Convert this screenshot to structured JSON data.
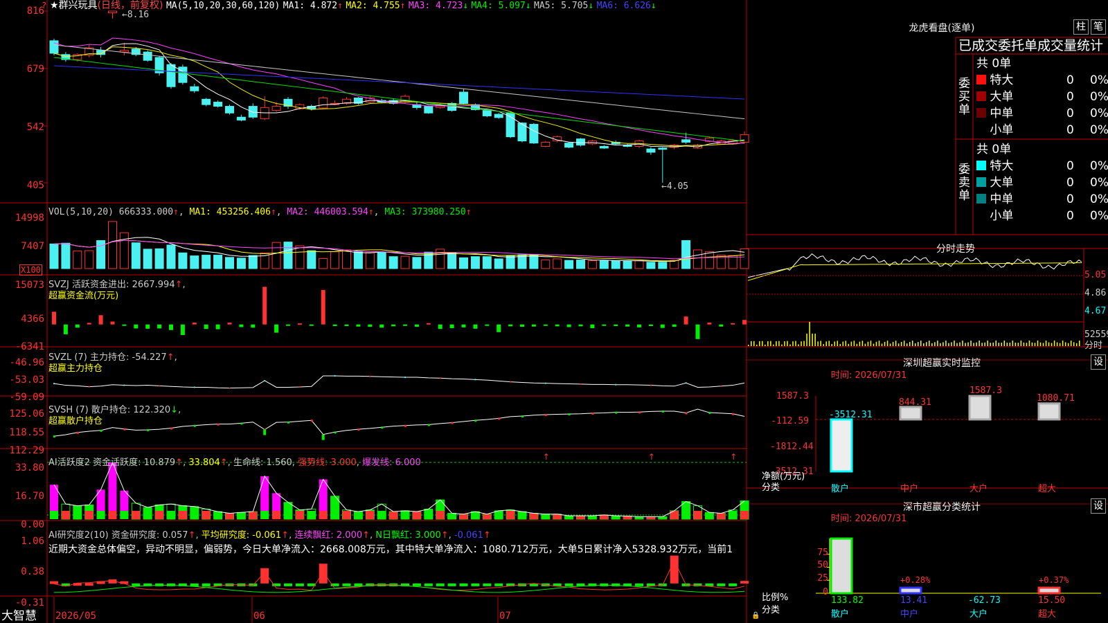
{
  "colors": {
    "up": "#ff3232",
    "down": "#4bf0f0",
    "grid": "#c00000",
    "ma1": "#ffffff",
    "ma2": "#f0f000",
    "ma3": "#ff40ff",
    "ma4": "#00e000",
    "ma5": "#c8c8c8",
    "ma6": "#3030ff"
  },
  "header": {
    "star": "★",
    "stock_name": "群兴玩具",
    "period": "(日线，前复权)",
    "ma_params": "MA(5,10,20,30,60,120)",
    "ma1_label": "MA1:",
    "ma1_value": "4.872",
    "ma2_label": "MA2:",
    "ma2_value": "4.755",
    "ma3_label": "MA3:",
    "ma3_value": "4.723",
    "ma4_label": "MA4:",
    "ma4_value": "5.097",
    "ma5_label": "MA5:",
    "ma5_value": "5.705",
    "ma6_label": "MA6:",
    "ma6_value": "6.626",
    "up_arrow": "↑",
    "down_arrow": "↓"
  },
  "candle_panel": {
    "y_ticks": [
      "816",
      "679",
      "542",
      "405"
    ],
    "high_label": "8.16",
    "low_label": "4.05",
    "question": "?"
  },
  "vol_panel": {
    "title": "VOL(5,10,20)",
    "value": "666333.000",
    "ma1_label": "MA1:",
    "ma1_value": "453256.406",
    "ma2_label": "MA2:",
    "ma2_value": "446003.594",
    "ma3_label": "MA3:",
    "ma3_value": "373980.250",
    "y_ticks": [
      "14998",
      "7407"
    ],
    "unit": "X100"
  },
  "svzj_panel": {
    "title": "SVZJ",
    "name": "活跃资金进出:",
    "value": "2667.994",
    "subtitle": "超赢资金流(万元)",
    "y_ticks": [
      "15073",
      "4366",
      "-6341"
    ]
  },
  "svzl_panel": {
    "title": "SVZL (7)",
    "name": "主力持仓:",
    "value": "-54.227",
    "subtitle": "超赢主力持仓",
    "y_ticks": [
      "-46.96",
      "-53.03",
      "-59.09"
    ]
  },
  "svsh_panel": {
    "title": "SVSH (7)",
    "name": "散户持仓:",
    "value": "122.320",
    "subtitle": "超赢散户持仓",
    "y_ticks": [
      "125.06",
      "118.55",
      "112.29"
    ]
  },
  "ai1_panel": {
    "title": "AI活跃度2",
    "name": "资金活跃度:",
    "value": "10.879",
    "v2": "33.804",
    "life_label": "生命线:",
    "life_value": "1.560",
    "strong_label": "强势线:",
    "strong_value": "3.000",
    "burst_label": "爆发线:",
    "burst_value": "6.000",
    "y_ticks": [
      "33.80",
      "16.70",
      "0.00"
    ]
  },
  "ai2_panel": {
    "title": "AI研究度2(10)",
    "name": "资金研究度:",
    "value": "0.057",
    "avg_label": "平均研究度:",
    "avg_value": "-0.061",
    "cont_label": "连续飘红:",
    "cont_value": "2.000",
    "n_label": "N日飘红:",
    "n_value": "3.000",
    "last_value": "-0.061",
    "text": "近期大资金总体偏空，异动不明显，偏弱势，今日大单净流入：2668.008万元，其中特大单净流入：1080.712万元，大单5日累计净入5328.932万元，当前1",
    "y_ticks": [
      "1.06",
      "0.38",
      "-0.31"
    ]
  },
  "x_axis": {
    "labels": [
      "2026/05",
      "06",
      "07"
    ],
    "brand": "大智慧"
  },
  "lhb": {
    "title": "龙虎看盘(逐单)",
    "tab1": "柱",
    "tab2": "笔",
    "subheader": "已成交委托单成交量统计",
    "buy": {
      "side": "委买单",
      "total": "共 0单",
      "rows": [
        {
          "name": "特大",
          "count": "0",
          "pct": "0%",
          "color": "#ff1010"
        },
        {
          "name": "大单",
          "count": "0",
          "pct": "0%",
          "color": "#a00000"
        },
        {
          "name": "中单",
          "count": "0",
          "pct": "0%",
          "color": "#6a0000"
        },
        {
          "name": "小单",
          "count": "0",
          "pct": "0%",
          "color": "#000000"
        }
      ]
    },
    "sell": {
      "side": "委卖单",
      "total": "共 0单",
      "rows": [
        {
          "name": "特大",
          "count": "0",
          "pct": "0%",
          "color": "#00ffff"
        },
        {
          "name": "大单",
          "count": "0",
          "pct": "0%",
          "color": "#00a0a0"
        },
        {
          "name": "中单",
          "count": "0",
          "pct": "0%",
          "color": "#008080"
        },
        {
          "name": "小单",
          "count": "0",
          "pct": "0%",
          "color": "#000000"
        }
      ]
    }
  },
  "timeshare": {
    "title": "分时走势",
    "y_labels": [
      "5.05",
      "4.86",
      "4.67",
      "52559",
      "分时"
    ]
  },
  "sz_monitor": {
    "title": "深圳超赢实时监控",
    "settings": "设",
    "time": "时间: 2026/07/31",
    "y_ticks": [
      "1587.3",
      "-112.59",
      "-1812.44",
      "-3512.31"
    ],
    "ylabel": "净额(万元)",
    "xlabel": "分类",
    "categories": [
      "散户",
      "中户",
      "大户",
      "超大"
    ],
    "values": [
      -3512.31,
      844.31,
      1587.3,
      1080.71
    ],
    "value_labels": [
      "-3512.31",
      "844.31",
      "1587.3",
      "1080.71"
    ]
  },
  "sz_classify": {
    "title": "深市超赢分类统计",
    "settings": "设",
    "time": "时间: 2026/07/31",
    "y_ticks": [
      "75",
      "50",
      "25",
      "0"
    ],
    "ylabel": "比例%",
    "xlabel": "分类",
    "categories": [
      "散户",
      "中户",
      "大户",
      "超大"
    ],
    "values": [
      133.82,
      13.41,
      -62.73,
      15.5
    ],
    "value_labels": [
      "133.82",
      "13.41",
      "-62.73",
      "15.50"
    ],
    "pct_labels": [
      "",
      "+0.28%",
      "",
      "+0.37%"
    ]
  },
  "chart_data": [
    {
      "type": "candlestick",
      "title": "群兴玩具(日线，前复权)",
      "ylim": [
        4.05,
        8.16
      ],
      "y_ticks": [
        8.16,
        6.79,
        5.42,
        4.05
      ],
      "x_labels": [
        "2026/05",
        "06",
        "07"
      ],
      "count": 60,
      "opens": [
        7.45,
        7.12,
        7.0,
        7.1,
        7.22,
        8.12,
        7.18,
        7.25,
        7.18,
        7.05,
        6.88,
        6.82,
        6.35,
        6.05,
        5.98,
        5.88,
        5.62,
        5.88,
        5.58,
        5.78,
        6.05,
        5.82,
        5.88,
        5.84,
        5.92,
        5.95,
        6.08,
        5.98,
        6.02,
        6.02,
        5.98,
        5.92,
        5.88,
        5.85,
        5.95,
        6.22,
        5.92,
        5.78,
        5.69,
        5.72,
        5.48,
        5.45,
        4.92,
        5.05,
        5.0,
        5.1,
        4.98,
        4.92,
        5.02,
        4.95,
        4.92,
        4.86,
        4.88,
        4.9,
        5.08,
        4.88,
        5.04,
        4.98,
        4.98,
        5.02
      ],
      "closes": [
        7.15,
        7.0,
        7.12,
        7.28,
        7.12,
        8.16,
        7.22,
        7.12,
        6.98,
        6.68,
        6.35,
        6.45,
        6.25,
        5.92,
        5.88,
        5.72,
        5.55,
        5.62,
        5.85,
        5.88,
        5.88,
        5.92,
        5.82,
        6.08,
        5.95,
        6.05,
        5.95,
        6.08,
        5.98,
        5.95,
        6.12,
        5.85,
        5.72,
        5.9,
        5.78,
        5.95,
        5.8,
        5.65,
        5.61,
        5.15,
        5.05,
        5.0,
        5.02,
        5.15,
        4.9,
        4.95,
        5.05,
        4.88,
        4.98,
        4.92,
        5.05,
        4.78,
        4.85,
        4.95,
        5.02,
        4.95,
        5.12,
        5.05,
        5.06,
        5.2
      ],
      "highs": [
        7.5,
        7.18,
        7.15,
        7.35,
        7.3,
        8.16,
        7.4,
        7.3,
        7.22,
        7.08,
        6.92,
        6.88,
        6.42,
        6.08,
        6.02,
        5.92,
        5.68,
        5.95,
        6.12,
        5.98,
        6.1,
        5.95,
        5.92,
        6.12,
        6.02,
        6.1,
        6.1,
        6.12,
        6.06,
        6.06,
        6.16,
        5.98,
        5.9,
        5.95,
        5.98,
        6.3,
        5.95,
        5.8,
        5.72,
        5.75,
        5.5,
        5.48,
        5.05,
        5.18,
        5.02,
        5.12,
        5.08,
        4.95,
        5.06,
        4.98,
        5.08,
        4.9,
        4.9,
        4.98,
        5.25,
        4.98,
        5.15,
        5.08,
        5.1,
        5.28
      ],
      "lows": [
        7.1,
        6.95,
        6.95,
        7.05,
        7.05,
        7.98,
        7.1,
        7.08,
        6.95,
        6.62,
        6.3,
        6.4,
        6.2,
        5.88,
        5.85,
        5.68,
        5.52,
        5.58,
        5.55,
        5.75,
        5.82,
        5.8,
        5.78,
        5.82,
        5.9,
        5.92,
        5.92,
        5.95,
        5.95,
        5.92,
        5.95,
        5.8,
        5.7,
        5.82,
        5.75,
        5.92,
        5.78,
        5.62,
        5.58,
        5.12,
        5.02,
        4.98,
        4.9,
        5.02,
        4.88,
        4.92,
        4.95,
        4.86,
        4.95,
        4.9,
        4.88,
        4.72,
        4.05,
        4.85,
        4.98,
        4.86,
        5.02,
        4.96,
        4.96,
        5.0
      ]
    },
    {
      "type": "bar",
      "title": "VOL(5,10,20)",
      "ylim": [
        0,
        14998
      ],
      "values": [
        6600,
        6800,
        4700,
        4800,
        7500,
        12600,
        9600,
        6900,
        5200,
        5300,
        6300,
        4200,
        3400,
        3600,
        3600,
        3000,
        2800,
        3500,
        4200,
        7000,
        7100,
        6100,
        4800,
        2700,
        4500,
        5000,
        4500,
        4300,
        4300,
        3200,
        3300,
        3000,
        4400,
        5200,
        4200,
        2900,
        3200,
        3200,
        2600,
        3500,
        3700,
        3800,
        2300,
        2600,
        2200,
        2300,
        2100,
        2100,
        2100,
        2000,
        2100,
        1700,
        1700,
        2200,
        7500,
        5000,
        4500,
        3600,
        3500,
        5300
      ]
    },
    {
      "type": "bar",
      "title": "SVZJ 活跃资金进出",
      "ylim": [
        -6341,
        15073
      ],
      "values": [
        4800,
        -3700,
        -1200,
        600,
        3500,
        1100,
        -200,
        -1500,
        -1600,
        -1500,
        -2100,
        -4000,
        700,
        -1700,
        -1800,
        700,
        -1000,
        -1200,
        14200,
        -3100,
        -500,
        400,
        -300,
        13000,
        -600,
        -600,
        -800,
        -900,
        -1200,
        -700,
        -500,
        -900,
        500,
        -1700,
        -1400,
        -1100,
        -1600,
        -500,
        -2900,
        -700,
        -900,
        -800,
        -500,
        -700,
        -1000,
        -700,
        -1400,
        -500,
        -600,
        -800,
        -1100,
        -600,
        -1300,
        -900,
        3000,
        -5500,
        700,
        -800,
        500,
        1700
      ]
    },
    {
      "type": "line",
      "title": "SVZL 主力持仓",
      "ylim": [
        -59.09,
        -46.96
      ],
      "values": [
        -56.2,
        -56.8,
        -57.0,
        -57.3,
        -57.1,
        -56.6,
        -56.8,
        -56.9,
        -56.8,
        -57.0,
        -57.2,
        -57.4,
        -57.5,
        -57.5,
        -57.7,
        -57.8,
        -57.7,
        -57.6,
        -55.2,
        -57.5,
        -57.5,
        -57.4,
        -57.2,
        -53.5,
        -53.5,
        -53.6,
        -53.6,
        -53.7,
        -53.8,
        -53.9,
        -54.0,
        -54.0,
        -54.2,
        -54.3,
        -54.5,
        -54.6,
        -54.8,
        -55.0,
        -55.3,
        -55.6,
        -55.8,
        -56.0,
        -56.1,
        -56.2,
        -56.3,
        -56.4,
        -56.5,
        -56.5,
        -56.6,
        -56.6,
        -56.7,
        -56.8,
        -57.0,
        -57.1,
        -56.0,
        -57.5,
        -57.4,
        -57.1,
        -56.8,
        -56.0
      ]
    },
    {
      "type": "line",
      "title": "SVSH 散户持仓",
      "ylim": [
        112.29,
        125.06
      ],
      "values": [
        115.4,
        115.9,
        116.7,
        117.1,
        117.4,
        118.4,
        117.9,
        117.5,
        117.6,
        117.8,
        118.2,
        118.8,
        119.1,
        119.4,
        119.6,
        119.6,
        119.9,
        120.3,
        117.7,
        120.2,
        120.3,
        120.6,
        120.9,
        116.0,
        116.8,
        117.4,
        117.8,
        118.1,
        118.5,
        118.9,
        119.1,
        119.3,
        119.4,
        119.8,
        120.1,
        120.5,
        120.9,
        121.2,
        121.6,
        122.2,
        122.4,
        122.7,
        122.9,
        123.0,
        123.1,
        123.2,
        123.4,
        123.5,
        123.7,
        123.7,
        123.8,
        124.0,
        124.1,
        124.1,
        123.5,
        124.8,
        123.6,
        123.4,
        123.2,
        122.3
      ]
    },
    {
      "type": "bar",
      "title": "AI活跃度2 资金活跃度",
      "ylim": [
        0,
        33.8
      ],
      "values": [
        20.5,
        9.0,
        8.0,
        8.5,
        17.6,
        33.8,
        17.0,
        9.5,
        7.0,
        8.5,
        9.0,
        8.0,
        7.5,
        6.0,
        4.5,
        3.5,
        4.0,
        4.5,
        25.6,
        15.5,
        10.0,
        5.5,
        6.0,
        23.7,
        13.7,
        5.5,
        4.5,
        5.5,
        9.0,
        4.5,
        5.0,
        4.5,
        6.0,
        11.5,
        3.5,
        3.0,
        4.5,
        3.0,
        5.0,
        5.5,
        4.5,
        3.5,
        3.0,
        3.0,
        2.0,
        2.0,
        2.0,
        2.5,
        2.0,
        1.8,
        1.5,
        1.5,
        1.5,
        5.0,
        10.5,
        8.0,
        4.0,
        3.5,
        5.5,
        10.9
      ]
    },
    {
      "type": "bar",
      "title": "AI研究度2(10) 资金研究度",
      "ylim": [
        -0.31,
        1.06
      ],
      "values": [
        0.05,
        -0.05,
        0.01,
        0.01,
        0.05,
        0.09,
        0.05,
        -0.04,
        -0.05,
        -0.04,
        -0.04,
        -0.04,
        -0.07,
        -0.07,
        -0.06,
        -0.04,
        -0.05,
        -0.05,
        0.34,
        -0.06,
        -0.06,
        -0.03,
        -0.05,
        0.44,
        -0.04,
        -0.06,
        -0.07,
        -0.04,
        -0.04,
        -0.04,
        -0.05,
        -0.04,
        -0.04,
        -0.05,
        -0.05,
        -0.05,
        -0.05,
        -0.04,
        -0.06,
        -0.05,
        -0.04,
        -0.01,
        -0.04,
        -0.05,
        -0.04,
        -0.05,
        -0.04,
        -0.04,
        -0.04,
        -0.05,
        -0.05,
        -0.04,
        -0.04,
        0.62,
        -0.05,
        -0.04,
        -0.04,
        -0.04,
        -0.04,
        0.057
      ]
    }
  ]
}
